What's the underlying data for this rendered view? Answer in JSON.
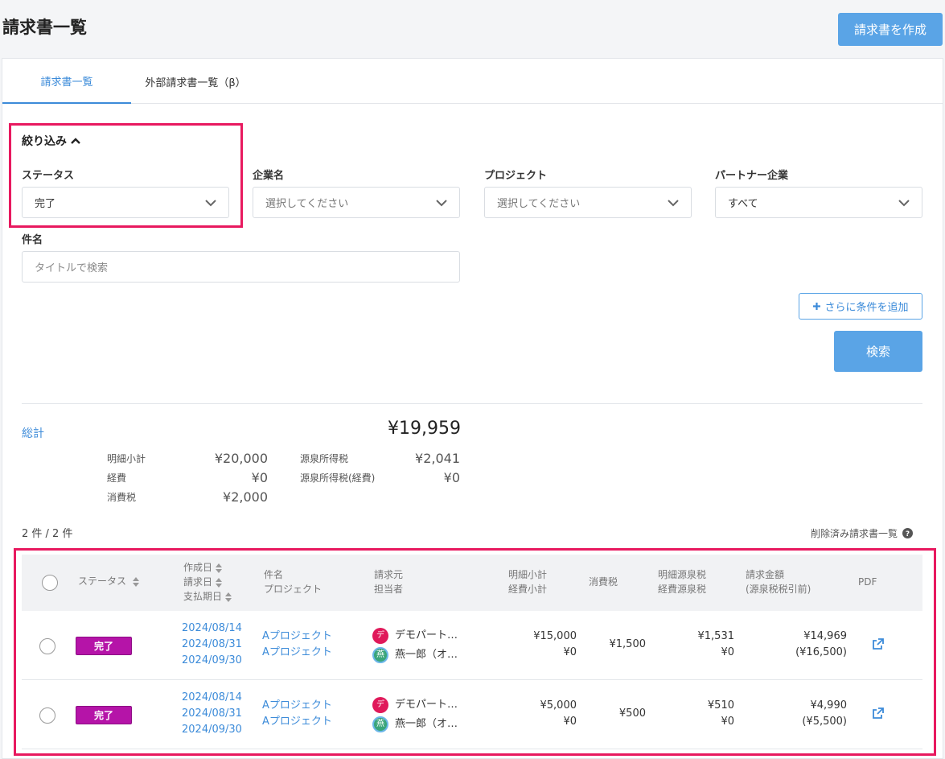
{
  "page": {
    "title": "請求書一覧",
    "create_button": "請求書を作成"
  },
  "tabs": [
    {
      "label": "請求書一覧",
      "active": true
    },
    {
      "label": "外部請求書一覧（β）",
      "active": false
    }
  ],
  "filters": {
    "title": "絞り込み",
    "status": {
      "label": "ステータス",
      "value": "完了"
    },
    "company": {
      "label": "企業名",
      "placeholder": "選択してください"
    },
    "project": {
      "label": "プロジェクト",
      "placeholder": "選択してください"
    },
    "partner": {
      "label": "パートナー企業",
      "value": "すべて"
    },
    "subject": {
      "label": "件名",
      "placeholder": "タイトルで検索"
    },
    "add_condition": "さらに条件を追加",
    "search": "検索"
  },
  "summary": {
    "label": "総計",
    "total": "¥19,959",
    "left": [
      {
        "label": "明細小計",
        "value": "¥20,000"
      },
      {
        "label": "経費",
        "value": "¥0"
      },
      {
        "label": "消費税",
        "value": "¥2,000"
      }
    ],
    "right": [
      {
        "label": "源泉所得税",
        "value": "¥2,041"
      },
      {
        "label": "源泉所得税(経費)",
        "value": "¥0"
      }
    ]
  },
  "list": {
    "count": "2 件 / 2 件",
    "deleted_link": "削除済み請求書一覧",
    "headers": {
      "status": "ステータス",
      "created": "作成日",
      "invoice_date": "請求日",
      "due_date": "支払期日",
      "subject": "件名",
      "project": "プロジェクト",
      "issuer": "請求元",
      "person": "担当者",
      "line_subtotal": "明細小計",
      "expense_subtotal": "経費小計",
      "tax": "消費税",
      "line_withholding": "明細源泉税",
      "expense_withholding": "経費源泉税",
      "amount": "請求金額",
      "amount_note": "(源泉税税引前)",
      "pdf": "PDF"
    },
    "rows": [
      {
        "status": "完了",
        "created": "2024/08/14",
        "invoice_date": "2024/08/31",
        "due_date": "2024/09/30",
        "subject": "Aプロジェクト",
        "project": "Aプロジェクト",
        "issuer_avatar": "デ",
        "issuer": "デモパート…",
        "person_avatar": "燕",
        "person": "燕一郎（オ…",
        "line_subtotal": "¥15,000",
        "expense_subtotal": "¥0",
        "tax": "¥1,500",
        "line_withholding": "¥1,531",
        "expense_withholding": "¥0",
        "amount": "¥14,969",
        "amount_before": "(¥16,500)"
      },
      {
        "status": "完了",
        "created": "2024/08/14",
        "invoice_date": "2024/08/31",
        "due_date": "2024/09/30",
        "subject": "Aプロジェクト",
        "project": "Aプロジェクト",
        "issuer_avatar": "デ",
        "issuer": "デモパート…",
        "person_avatar": "燕",
        "person": "燕一郎（オ…",
        "line_subtotal": "¥5,000",
        "expense_subtotal": "¥0",
        "tax": "¥500",
        "line_withholding": "¥510",
        "expense_withholding": "¥0",
        "amount": "¥4,990",
        "amount_before": "(¥5,500)"
      }
    ]
  },
  "colors": {
    "accent": "#3c8bd9",
    "button": "#5aa4e6",
    "highlight": "#e8195f",
    "status_done": "#b514a8"
  }
}
